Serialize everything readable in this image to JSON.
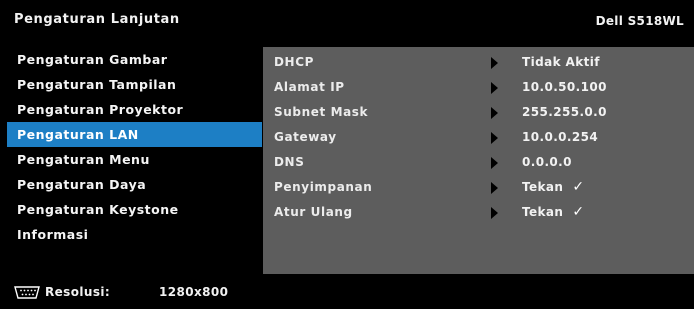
{
  "header": {
    "title": "Pengaturan Lanjutan",
    "model": "Dell S518WL"
  },
  "menu": {
    "items": [
      {
        "label": "Pengaturan Gambar"
      },
      {
        "label": "Pengaturan Tampilan"
      },
      {
        "label": "Pengaturan Proyektor"
      },
      {
        "label": "Pengaturan LAN",
        "active": true
      },
      {
        "label": "Pengaturan Menu"
      },
      {
        "label": "Pengaturan Daya"
      },
      {
        "label": "Pengaturan Keystone"
      },
      {
        "label": "Informasi"
      }
    ]
  },
  "panel": {
    "rows": [
      {
        "label": "DHCP",
        "value": "Tidak Aktif"
      },
      {
        "label": "Alamat IP",
        "value": "10.0.50.100"
      },
      {
        "label": "Subnet Mask",
        "value": "255.255.0.0"
      },
      {
        "label": "Gateway",
        "value": "10.0.0.254"
      },
      {
        "label": "DNS",
        "value": "0.0.0.0"
      },
      {
        "label": "Penyimpanan",
        "value": "Tekan",
        "icon": "check-icon"
      },
      {
        "label": "Atur Ulang",
        "value": "Tekan",
        "icon": "check-icon"
      }
    ],
    "check_glyph": "✓",
    "arrow_icon": "arrow-right-icon"
  },
  "footer": {
    "icon": "vga-connector-icon",
    "label": "Resolusi:",
    "value": "1280x800"
  },
  "colors": {
    "background": "#000000",
    "active_item": "#1d7fc5",
    "panel": "#5d5d5d"
  }
}
